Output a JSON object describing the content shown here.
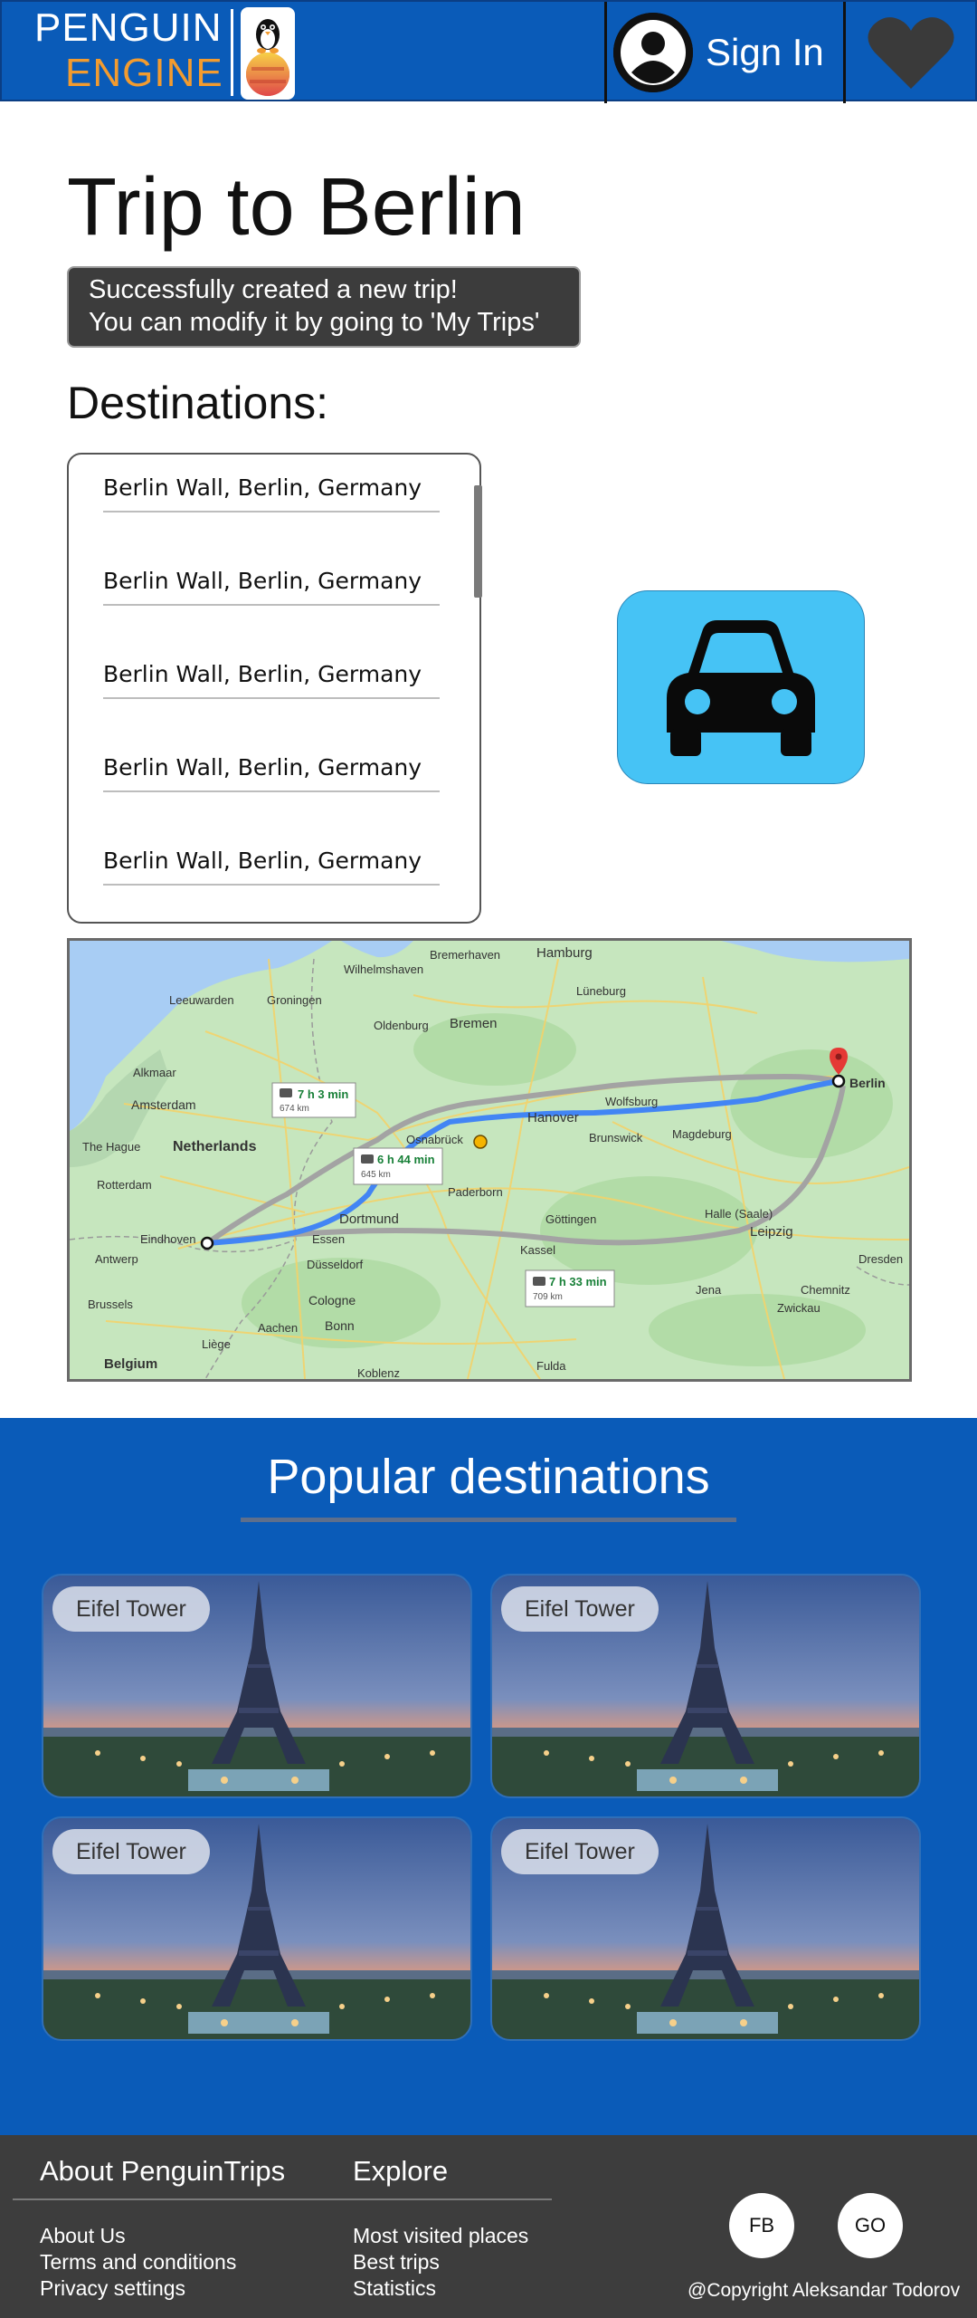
{
  "header": {
    "logo_line1": "PENGUIN",
    "logo_line2": "ENGINE",
    "sign_in_label": "Sign In",
    "avatar_icon": "user-avatar-icon",
    "favorite_icon": "heart-icon"
  },
  "main": {
    "title": "Trip to Berlin",
    "toast_line1": "Successfully created a new trip!",
    "toast_line2": "You can modify it by going to 'My Trips'",
    "destinations_heading": "Destinations:",
    "destinations": [
      "Berlin Wall, Berlin, Germany",
      "Berlin Wall, Berlin, Germany",
      "Berlin Wall, Berlin, Germany",
      "Berlin Wall, Berlin, Germany",
      "Berlin Wall, Berlin, Germany"
    ],
    "transport_icon": "car-icon"
  },
  "map": {
    "cities": [
      "Bremerhaven",
      "Hamburg",
      "Groningen",
      "Wilhelmshaven",
      "Lüneburg",
      "Leeuwarden",
      "Oldenburg",
      "Bremen",
      "Alkmaar",
      "Amsterdam",
      "Berlin",
      "Wolfsburg",
      "Hanover",
      "The Hague",
      "Netherlands",
      "Brunswick",
      "Magdeburg",
      "Rotterdam",
      "Osnabrück",
      "Paderborn",
      "Eindhoven",
      "Essen",
      "Dortmund",
      "Göttingen",
      "Halle (Saale)",
      "Leipzig",
      "Antwerp",
      "Düsseldorf",
      "Kassel",
      "Dresden",
      "Brussels",
      "Cologne",
      "Jena",
      "Chemnitz",
      "Aachen",
      "Zwickau",
      "Bonn",
      "Liège",
      "Belgium",
      "Koblenz",
      "Fulda"
    ],
    "routes": [
      {
        "time": "7 h 3 min",
        "distance": "674 km"
      },
      {
        "time": "6 h 44 min",
        "distance": "645 km"
      },
      {
        "time": "7 h 33 min",
        "distance": "709 km"
      }
    ],
    "destination_label": "Berlin"
  },
  "popular": {
    "title": "Popular destinations",
    "cards": [
      {
        "label": "Eifel Tower"
      },
      {
        "label": "Eifel Tower"
      },
      {
        "label": "Eifel Tower"
      },
      {
        "label": "Eifel Tower"
      }
    ]
  },
  "footer": {
    "about_heading": "About PenguinTrips",
    "explore_heading": "Explore",
    "about_links": [
      "About Us",
      "Terms and conditions",
      "Privacy settings"
    ],
    "explore_links": [
      "Most visited places",
      "Best trips",
      "Statistics"
    ],
    "social_buttons": [
      "FB",
      "GO"
    ],
    "copyright": "@Copyright Aleksandar Todorov"
  },
  "colors": {
    "brand_blue": "#0a5bb8",
    "brand_orange": "#f29b2f",
    "accent_cyan": "#46c3f5",
    "footer_gray": "#3d3d3d"
  }
}
